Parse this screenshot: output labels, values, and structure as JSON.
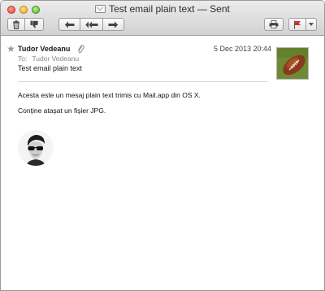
{
  "window": {
    "title": "Test email plain text — Sent"
  },
  "toolbar": {
    "buttons": [
      {
        "name": "delete",
        "icon": "trash-icon"
      },
      {
        "name": "junk",
        "icon": "thumbs-down-icon"
      },
      {
        "name": "reply",
        "icon": "reply-icon"
      },
      {
        "name": "reply-all",
        "icon": "reply-all-icon"
      },
      {
        "name": "forward",
        "icon": "forward-icon"
      },
      {
        "name": "print",
        "icon": "printer-icon"
      },
      {
        "name": "flag",
        "icon": "flag-icon"
      }
    ],
    "flag_color": "#d9302c"
  },
  "message": {
    "from": "Tudor Vedeanu",
    "to_label": "To:",
    "to": "Tudor Vedeanu",
    "date": "5 Dec 2013 20:44",
    "subject": "Test email plain text",
    "body": [
      "Acesta este un mesaj plain text trimis cu Mail.app din OS X.",
      "Conține atașat un fișier JPG."
    ],
    "has_attachment": true,
    "starred": false
  }
}
